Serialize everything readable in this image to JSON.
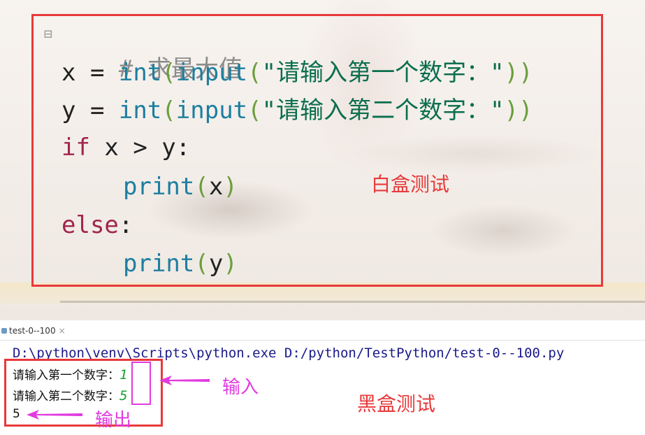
{
  "editor": {
    "comment": "# 求最大值",
    "lines": [
      {
        "pre": "x = ",
        "fn1": "int",
        "p1": "(",
        "fn2": "input",
        "p2": "(",
        "str": "\"请输入第一个数字：\"",
        "p3": "))"
      },
      {
        "pre": "y = ",
        "fn1": "int",
        "p1": "(",
        "fn2": "input",
        "p2": "(",
        "str": "\"请输入第二个数字：\"",
        "p3": "))"
      }
    ],
    "if_kw": "if",
    "if_rest": " x > y:",
    "print1_fn": "print",
    "print1_open": "(",
    "print1_arg": "x",
    "print1_close": ")",
    "else_kw": "else",
    "else_colon": ":",
    "print2_fn": "print",
    "print2_open": "(",
    "print2_arg": "y",
    "print2_close": ")"
  },
  "annotations": {
    "white_box": "白盒测试",
    "black_box": "黑盒测试",
    "input": "输入",
    "output": "输出"
  },
  "run_panel": {
    "tab_label": "test-0--100",
    "tab_close": "×",
    "command": "D:\\python\\venv\\Scripts\\python.exe D:/python/TestPython/test-0--100.py",
    "prompt1": "请输入第一个数字：",
    "value1": "1",
    "prompt2": "请输入第二个数字：",
    "value2": "5",
    "result": "5"
  },
  "colors": {
    "red_box": "#e8393a",
    "magenta": "#e13ae0",
    "keyword": "#a0254c",
    "function": "#1d7ea0",
    "string": "#0b6e4f"
  }
}
